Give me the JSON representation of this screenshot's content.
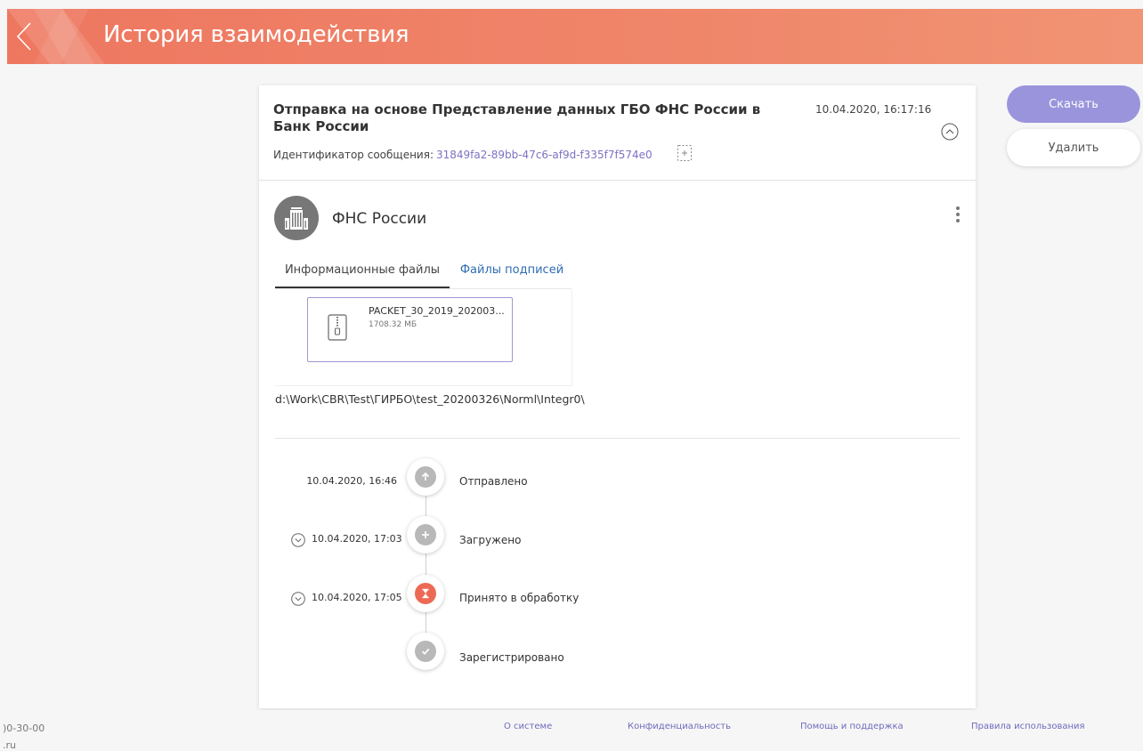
{
  "header": {
    "title": "История взаимодействия",
    "gradient_start": "#ee7760",
    "gradient_end": "#f19474"
  },
  "message": {
    "title": "Отправка на основе Представление данных ГБО ФНС России в Банк России",
    "datetime": "10.04.2020, 16:17:16",
    "id_label": "Идентификатор сообщения:",
    "id_value": "31849fa2-89bb-47c6-af9d-f335f7f574e0"
  },
  "organization": {
    "name": "ФНС России",
    "icon": "building-icon"
  },
  "tabs": [
    {
      "label": "Информационные файлы",
      "active": true
    },
    {
      "label": "Файлы подписей",
      "active": false
    }
  ],
  "file": {
    "name": "PACKET_30_2019_202003...",
    "size": "1708.32 МБ",
    "icon": "zip-file-icon"
  },
  "file_path": "d:\\Work\\CBR\\Test\\ГИРБО\\test_20200326\\Norml\\Integr0\\",
  "timeline": [
    {
      "date": "10.04.2020, 16:46",
      "label": "Отправлено",
      "icon": "arrow-up-icon",
      "color": "#b8b8b8",
      "expandable": false
    },
    {
      "date": "10.04.2020, 17:03",
      "label": "Загружено",
      "icon": "plus-icon",
      "color": "#b8b8b8",
      "expandable": true
    },
    {
      "date": "10.04.2020, 17:05",
      "label": "Принято в обработку",
      "icon": "hourglass-icon",
      "color": "#ec6a55",
      "expandable": true
    },
    {
      "date": "",
      "label": "Зарегистрировано",
      "icon": "check-icon",
      "color": "#b8b8b8",
      "expandable": false
    }
  ],
  "actions": {
    "download": "Скачать",
    "delete": "Удалить",
    "accent": "#9a94dc"
  },
  "footer": {
    "left_line1": ")0-30-00",
    "left_line2": ".ru",
    "links": [
      "О системе",
      "Конфиденциальность",
      "Помощь и поддержка",
      "Правила использования"
    ]
  }
}
